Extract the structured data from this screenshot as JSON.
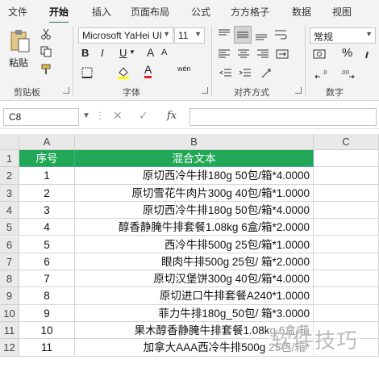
{
  "menu": {
    "tabs": [
      "文件",
      "开始",
      "插入",
      "页面布局",
      "公式",
      "方方格子",
      "数据",
      "视图"
    ],
    "active": "开始"
  },
  "ribbon": {
    "clipboard": {
      "label": "剪贴板",
      "paste": "粘贴"
    },
    "font": {
      "label": "字体",
      "name": "Microsoft YaHei UI",
      "size": "11",
      "bold": "B",
      "italic": "I",
      "underline": "U",
      "grow": "A",
      "shrink": "A",
      "color_glyph": "A",
      "phonetic": "wén",
      "fill_color": "#ffff00",
      "font_color": "#e02020"
    },
    "alignment": {
      "label": "对齐方式"
    },
    "number": {
      "label": "数字",
      "format": "常规",
      "percent": "%"
    }
  },
  "formula_bar": {
    "name_box": "C8",
    "cancel": "✕",
    "confirm": "✓",
    "fx": "fx",
    "value": ""
  },
  "grid": {
    "col_headers": [
      "A",
      "B",
      "C"
    ],
    "row_numbers": [
      "1",
      "2",
      "3",
      "4",
      "5",
      "6",
      "7",
      "8",
      "9",
      "10",
      "11",
      "12"
    ],
    "header_row": [
      "序号",
      "混合文本"
    ],
    "rows": [
      [
        "1",
        "原切西冷牛排180g 50包/箱*4.0000"
      ],
      [
        "2",
        "原切雪花牛肉片300g 40包/箱*1.0000"
      ],
      [
        "3",
        "原切西冷牛排180g 50包/箱*4.0000"
      ],
      [
        "4",
        "醇香静腌牛排套餐1.08kg 6盒/箱*2.0000"
      ],
      [
        "5",
        "西冷牛排500g 25包/箱*1.0000"
      ],
      [
        "6",
        "眼肉牛排500g 25包/ 箱*2.0000"
      ],
      [
        "7",
        "原切汉堡饼300g 40包/箱*4.0000"
      ],
      [
        "8",
        "原切进口牛排套餐A240*1.0000"
      ],
      [
        "9",
        "菲力牛排180g_50包/ 箱*3.0000"
      ],
      [
        "10",
        "果木醇香静腌牛排套餐1.08kg 6盒/箱"
      ],
      [
        "11",
        "加拿大AAA西冷牛排500g 25包/箱*"
      ]
    ],
    "header_fill": "#21a857"
  },
  "watermark": "软件技巧"
}
